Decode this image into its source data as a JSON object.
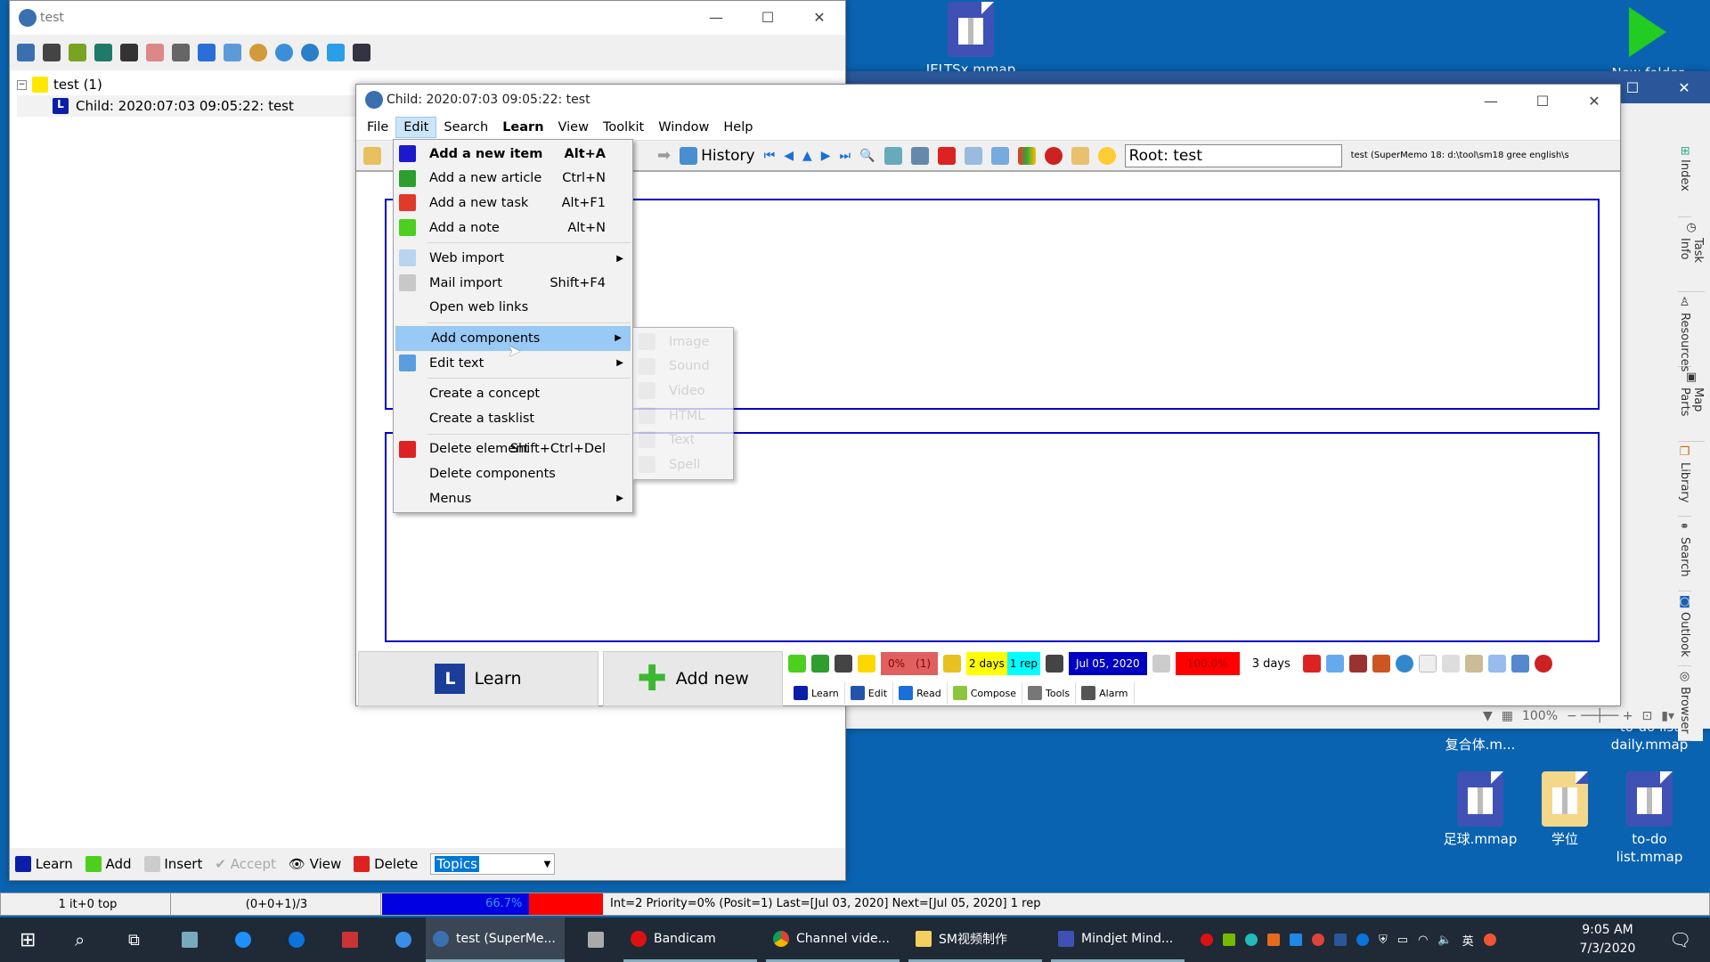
{
  "desktop": {
    "icons": [
      {
        "label": "IELTSx.mmap"
      },
      {
        "label": "New folder"
      },
      {
        "label": "复合体.m..."
      },
      {
        "label": "to-do list daily.mmap"
      },
      {
        "label": "足球.mmap"
      },
      {
        "label": "学位"
      },
      {
        "label": "to-do list.mmap"
      }
    ]
  },
  "main_window": {
    "title": "test",
    "tree": [
      {
        "label": "test (1)",
        "icon": "lightbulb-icon"
      },
      {
        "label": "Child: 2020:07:03 09:05:22: test",
        "icon": "learn-item-icon"
      }
    ],
    "bottom_toolbar": {
      "learn": "Learn",
      "add": "Add",
      "insert": "Insert",
      "accept": "Accept",
      "view": "View",
      "delete": "Delete",
      "category_select": "Topics"
    }
  },
  "mindjet": {
    "zoom": "100%",
    "side_tabs": [
      "Index",
      "Task Info",
      "Resources",
      "Map Parts",
      "Library",
      "Search",
      "Outlook",
      "Browser"
    ]
  },
  "child_window": {
    "title": "Child: 2020:07:03 09:05:22: test",
    "menubar": [
      "File",
      "Edit",
      "Search",
      "Learn",
      "View",
      "Toolkit",
      "Window",
      "Help"
    ],
    "active_menu": "Edit",
    "toolbar": {
      "history": "History",
      "root_field": "Root: test",
      "collection_info": "test (SuperMemo 18: d:\\tool\\sm18 gree english\\s"
    },
    "learn_button": "Learn",
    "add_new_button": "Add new",
    "status": {
      "priority": "0%",
      "count": "(1)",
      "interval": "2 days",
      "reps": "1 rep",
      "next_date": "Jul 05, 2020",
      "retention": "100.0%",
      "days": "3 days"
    },
    "tabs": [
      "Learn",
      "Edit",
      "Read",
      "Compose",
      "Tools",
      "Alarm"
    ],
    "colors": {
      "frame": "#0000c8",
      "date_bg": "#0000c0",
      "interval_bg": "#ffff00",
      "rep_bg": "#00ffff",
      "retention_bg": "#ff0000"
    }
  },
  "edit_menu": {
    "items": [
      {
        "label": "Add a new item",
        "shortcut": "Alt+A",
        "bold": true,
        "icon": "add-item-icon",
        "color": "#1a1acc"
      },
      {
        "label": "Add a new article",
        "shortcut": "Ctrl+N",
        "icon": "add-article-icon",
        "color": "#2e9e2e"
      },
      {
        "label": "Add a new task",
        "shortcut": "Alt+F1",
        "icon": "add-task-icon",
        "color": "#e03a2a"
      },
      {
        "label": "Add a note",
        "shortcut": "Alt+N",
        "icon": "add-note-icon",
        "color": "#4ccf1f"
      },
      {
        "sep": true
      },
      {
        "label": "Web import",
        "submenu": true,
        "icon": "web-import-icon",
        "color": "#b8d4ef"
      },
      {
        "label": "Mail import",
        "shortcut": "Shift+F4",
        "icon": "mail-import-icon",
        "color": "#c8c8c8"
      },
      {
        "label": "Open web links"
      },
      {
        "sep": true
      },
      {
        "label": "Add components",
        "submenu": true,
        "highlighted": true
      },
      {
        "label": "Edit text",
        "submenu": true,
        "icon": "edit-text-icon",
        "color": "#5a9ee0"
      },
      {
        "sep": true
      },
      {
        "label": "Create a concept"
      },
      {
        "label": "Create a tasklist"
      },
      {
        "sep": true
      },
      {
        "label": "Delete element",
        "shortcut": "Shift+Ctrl+Del",
        "icon": "delete-icon",
        "color": "#dd2222"
      },
      {
        "label": "Delete components"
      },
      {
        "label": "Menus",
        "submenu": true
      }
    ],
    "submenu": [
      "Image",
      "Sound",
      "Video",
      "HTML",
      "Text",
      "Spell"
    ]
  },
  "statusbar": {
    "cell1": "1 it+0 top",
    "cell2": "(0+0+1)/3",
    "progress": "66.7%",
    "progress_value": 66.7,
    "info": "Int=2 Priority=0% (Posit=1) Last=[Jul 03, 2020] Next=[Jul 05, 2020] 1 rep"
  },
  "taskbar": {
    "apps": [
      "test (SuperMe...",
      "Bandicam",
      "Channel vide...",
      "SM视频制作",
      "Mindjet Mind..."
    ],
    "ime": "英",
    "time": "9:05 AM",
    "date": "7/3/2020"
  }
}
